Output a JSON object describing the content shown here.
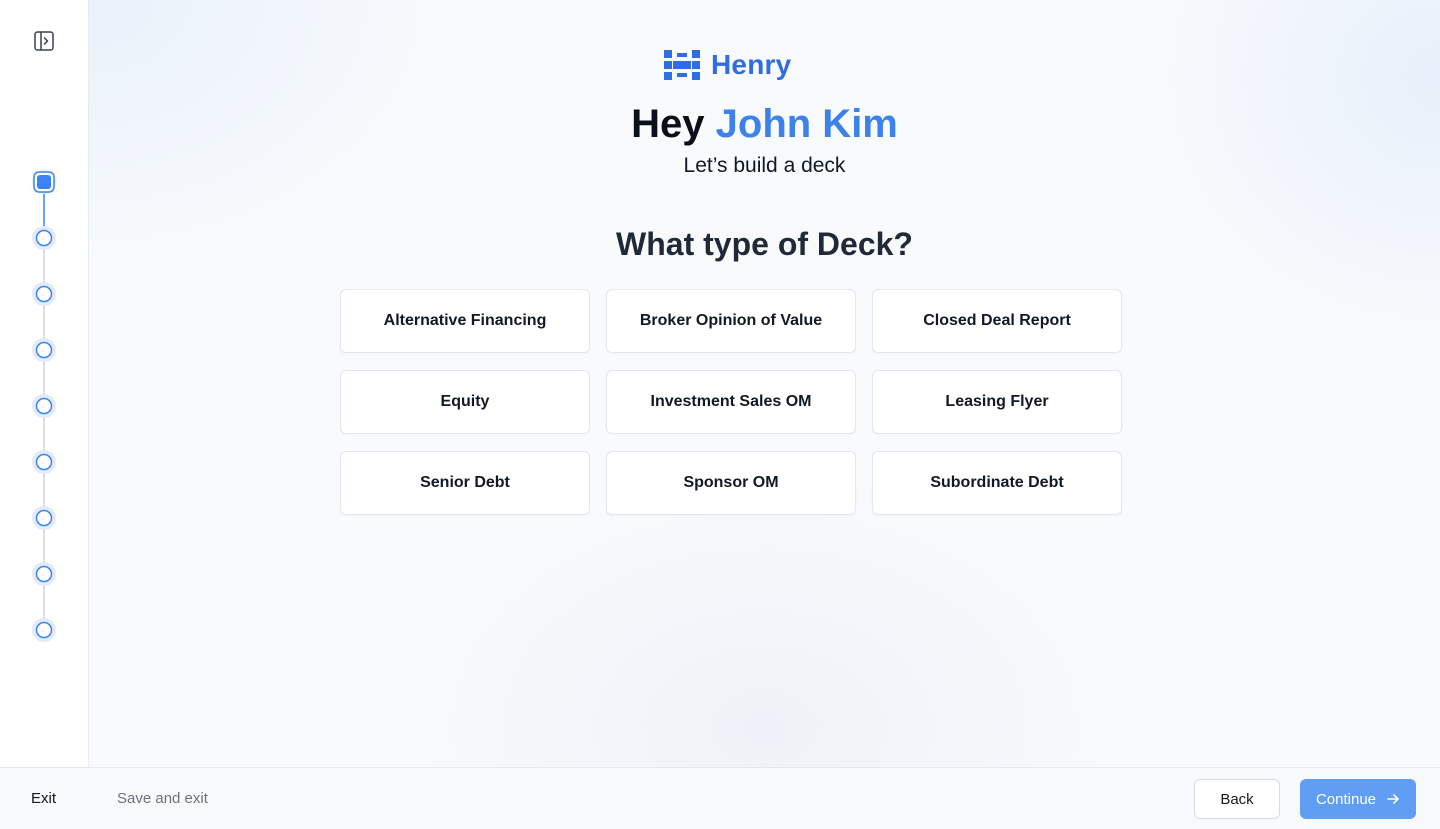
{
  "brand": {
    "name": "Henry",
    "color": "#2f6de1"
  },
  "greeting": {
    "prefix": "Hey",
    "name": "John Kim",
    "subtitle": "Let’s build a deck"
  },
  "question": {
    "prefix": "What type of",
    "emphasis": "Deck?"
  },
  "deck_types": [
    "Alternative Financing",
    "Broker Opinion of Value",
    "Closed Deal Report",
    "Equity",
    "Investment Sales OM",
    "Leasing Flyer",
    "Senior Debt",
    "Sponsor OM",
    "Subordinate Debt"
  ],
  "stepper": {
    "total_steps": 9,
    "current_step": 1,
    "accent": "#3b82f6"
  },
  "sidebar": {
    "toggle_icon": "sidebar-expand-icon"
  },
  "footer": {
    "exit_label": "Exit",
    "save_exit_label": "Save and exit",
    "back_label": "Back",
    "continue_label": "Continue",
    "continue_icon": "arrow-right-icon"
  }
}
